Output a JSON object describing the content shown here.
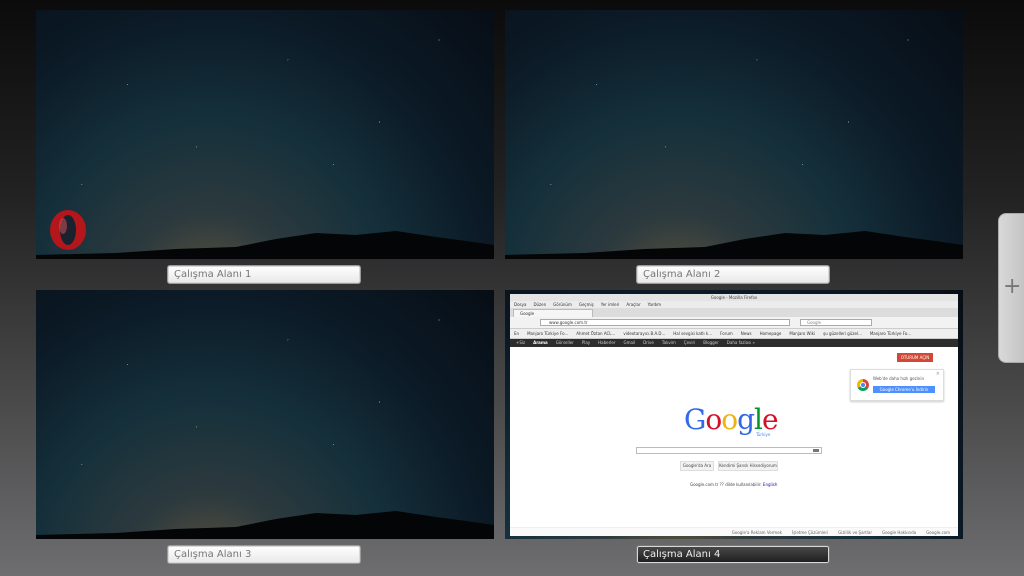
{
  "workspaces": [
    {
      "label": "Çalışma Alanı 1",
      "active": false
    },
    {
      "label": "Çalışma Alanı 2",
      "active": false
    },
    {
      "label": "Çalışma Alanı 3",
      "active": false
    },
    {
      "label": "Çalışma Alanı 4",
      "active": true
    }
  ],
  "add_workspace": {
    "icon": "plus-icon",
    "glyph": "+"
  },
  "dock_icon": "opera-icon",
  "firefox": {
    "title": "Google - Mozilla Firefox",
    "menu": [
      "Dosya",
      "Düzen",
      "Görünüm",
      "Geçmiş",
      "Yer imleri",
      "Araçlar",
      "Yardım"
    ],
    "tab": "Google",
    "url": "www.google.com.tr",
    "search_placeholder": "Google",
    "bookmarks": [
      "En",
      "Manjaro Türkiye Fo...",
      "Ahmet Öztan ACL...",
      "videotarayıcı.B.A.D...",
      "Hal sevgisi katlı k...",
      "Forum",
      "News",
      "Homepage",
      "Manjaro Wiki",
      "şu güzelleri güzel...",
      "Manjaro Türkiye Fo..."
    ],
    "google_bar": [
      "+Siz",
      "Arama",
      "Görseller",
      "Play",
      "Haberler",
      "Gmail",
      "Drive",
      "Takvim",
      "Çeviri",
      "Blogger",
      "Daha fazlası »"
    ],
    "signin": "OTURUM AÇIN",
    "promo_text": "Web'de daha hızlı gezinin",
    "promo_button": "Google Chrome'u İndirin",
    "logo": {
      "G": "G",
      "o1": "o",
      "o2": "o",
      "g": "g",
      "l": "l",
      "e": "e"
    },
    "logo_sub": "Türkiye",
    "buttons": [
      "Google'da Ara",
      "Kendimi Şanslı Hissediyorum"
    ],
    "lang_text": "Google.com.tr ?? dilde kullanılabilir:",
    "lang_link": "English",
    "footer": [
      "Google'a Reklam Vermek",
      "İşletme Çözümleri",
      "Gizlilik ve Şartlar",
      "Google Hakkında",
      "Google.com"
    ]
  },
  "colors": {
    "active_label_bg": "#2a2a2a",
    "label_bg": "#f4f4f4",
    "accent_red": "#c0392b"
  }
}
